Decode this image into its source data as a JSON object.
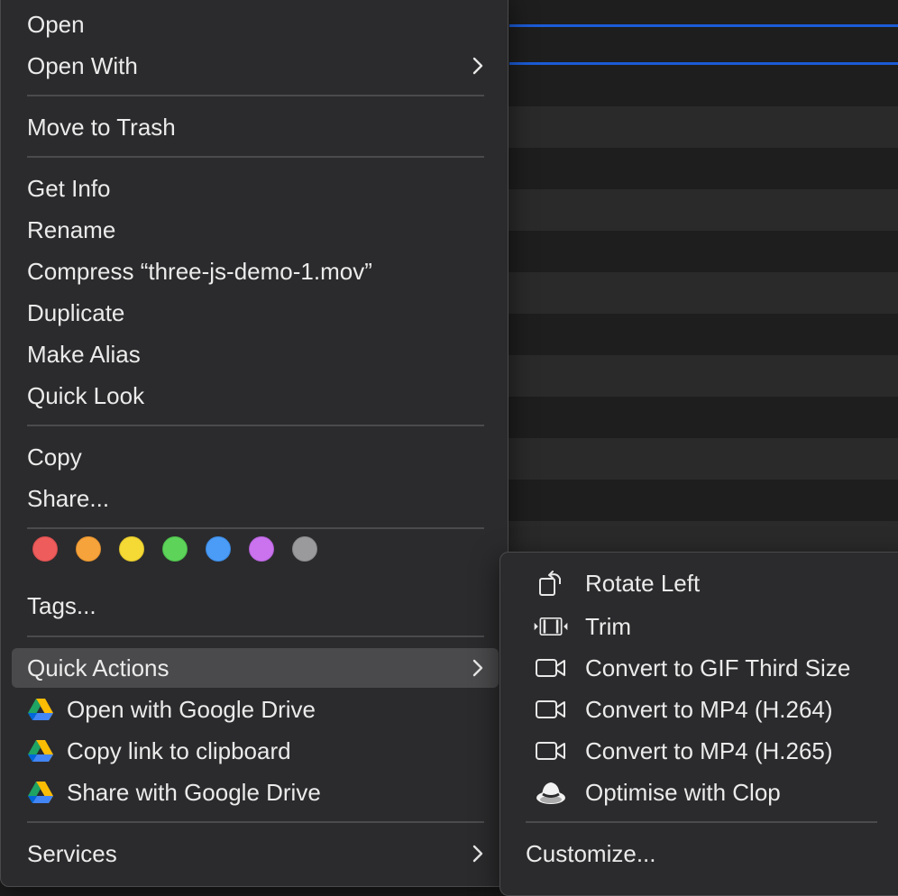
{
  "menu": {
    "items": {
      "open": "Open",
      "open_with": "Open With",
      "move_to_trash": "Move to Trash",
      "get_info": "Get Info",
      "rename": "Rename",
      "compress": "Compress “three-js-demo-1.mov”",
      "duplicate": "Duplicate",
      "make_alias": "Make Alias",
      "quick_look": "Quick Look",
      "copy": "Copy",
      "share": "Share...",
      "tags": "Tags...",
      "quick_actions": "Quick Actions",
      "open_with_google_drive": "Open with Google Drive",
      "copy_link": "Copy link to clipboard",
      "share_with_google_drive": "Share with Google Drive",
      "services": "Services"
    },
    "tag_colors": [
      "#ee5c5c",
      "#f7a33b",
      "#f5d935",
      "#5dd35a",
      "#4a9cf7",
      "#cb73ef",
      "#9a9a9c"
    ]
  },
  "submenu": {
    "items": {
      "rotate_left": "Rotate Left",
      "trim": "Trim",
      "convert_gif": "Convert to GIF Third Size",
      "convert_mp4_264": "Convert to MP4 (H.264)",
      "convert_mp4_265": "Convert to MP4 (H.265)",
      "optimise_clop": "Optimise with Clop",
      "customize": "Customize..."
    }
  },
  "colors": {
    "selection_line": "#1b5bd6",
    "menu_bg": "#2b2b2d",
    "highlight": "#4a4a4c"
  }
}
